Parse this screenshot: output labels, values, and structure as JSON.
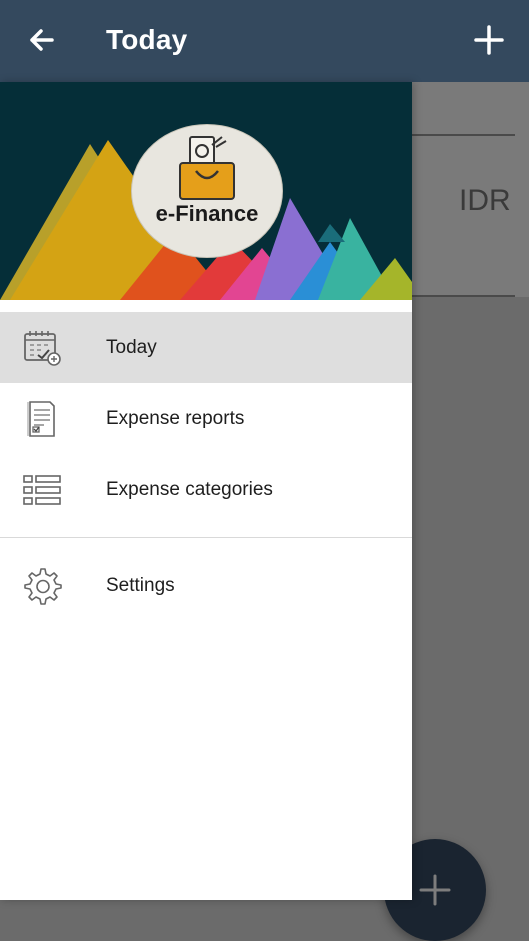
{
  "appbar": {
    "title": "Today",
    "back_icon": "arrow-left-icon",
    "add_icon": "plus-icon",
    "background": "#34495e"
  },
  "background_content": {
    "currency": "IDR"
  },
  "drawer": {
    "logo_text": "e-Finance",
    "logo_icon": "shopping-bag-icon",
    "header_background": "#052e38",
    "items": [
      {
        "label": "Today",
        "icon": "calendar-check-icon",
        "active": true
      },
      {
        "label": "Expense reports",
        "icon": "report-document-icon",
        "active": false
      },
      {
        "label": "Expense categories",
        "icon": "list-icon",
        "active": false
      }
    ],
    "secondary_items": [
      {
        "label": "Settings",
        "icon": "gear-icon"
      }
    ]
  },
  "fab": {
    "icon": "plus-icon"
  }
}
